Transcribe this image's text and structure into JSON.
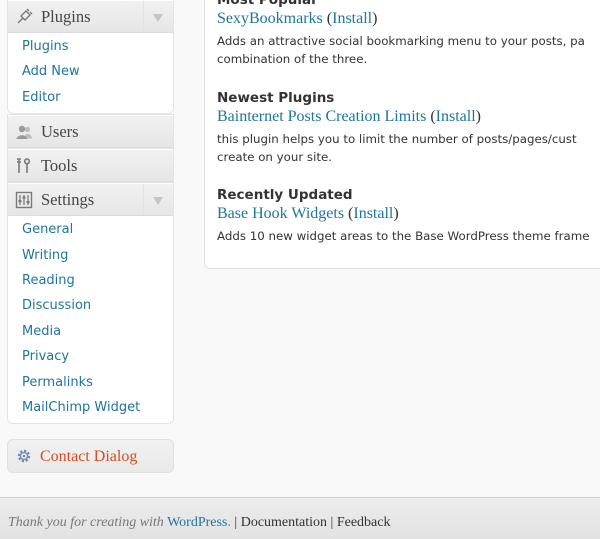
{
  "menu": {
    "plugins": {
      "label": "Plugins",
      "items": [
        "Plugins",
        "Add New",
        "Editor"
      ]
    },
    "users": {
      "label": "Users"
    },
    "tools": {
      "label": "Tools"
    },
    "settings": {
      "label": "Settings",
      "items": [
        "General",
        "Writing",
        "Reading",
        "Discussion",
        "Media",
        "Privacy",
        "Permalinks",
        "MailChimp Widget"
      ]
    },
    "contact": {
      "label": "Contact Dialog"
    }
  },
  "content": {
    "popular": {
      "heading": "Most Popular",
      "plugin": "SexyBookmarks",
      "install": "Install",
      "desc1": "Adds an attractive social bookmarking menu to your posts, pa",
      "desc2": "combination of the three."
    },
    "newest": {
      "heading": "Newest Plugins",
      "plugin": "Bainternet Posts Creation Limits",
      "install": "Install",
      "desc1": "this plugin helps you to limit the number of posts/pages/cust",
      "desc2": "create on your site."
    },
    "updated": {
      "heading": "Recently Updated",
      "plugin": "Base Hook Widgets",
      "install": "Install",
      "desc1": "Adds 10 new widget areas to the Base WordPress theme frame"
    }
  },
  "footer": {
    "thanks": "Thank you for creating with",
    "wordpress": "WordPress",
    "period": ".",
    "sep": " | ",
    "documentation": "Documentation",
    "feedback": "Feedback"
  },
  "colors": {
    "link": "#21759b",
    "accent": "#d54e21"
  }
}
